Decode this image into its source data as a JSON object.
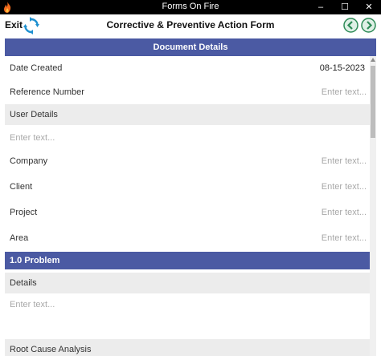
{
  "window": {
    "title": "Forms On Fire",
    "minimize_glyph": "–",
    "maximize_glyph": "☐",
    "close_glyph": "✕"
  },
  "toolbar": {
    "exit_label": "Exit",
    "form_title": "Corrective & Preventive Action Form",
    "icons": [
      "fire-icon",
      "sync-icon",
      "back-arrow-icon",
      "forward-arrow-icon"
    ]
  },
  "colors": {
    "header_blue": "#4b5aa3",
    "nav_green": "#2e8b57",
    "sync_blue": "#1e90d0",
    "group_grey": "#ececec"
  },
  "sections": {
    "document_details": {
      "header": "Document Details",
      "date_created_label": "Date Created",
      "date_created_value": "08-15-2023",
      "reference_number_label": "Reference Number",
      "reference_number_placeholder": "Enter text...",
      "user_details_label": "User Details",
      "user_details_placeholder": "Enter text...",
      "company_label": "Company",
      "company_placeholder": "Enter text...",
      "client_label": "Client",
      "client_placeholder": "Enter text...",
      "project_label": "Project",
      "project_placeholder": "Enter text...",
      "area_label": "Area",
      "area_placeholder": "Enter text..."
    },
    "problem": {
      "header": "1.0 Problem",
      "details_label": "Details",
      "details_placeholder": "Enter text...",
      "root_cause_label": "Root Cause Analysis"
    }
  }
}
